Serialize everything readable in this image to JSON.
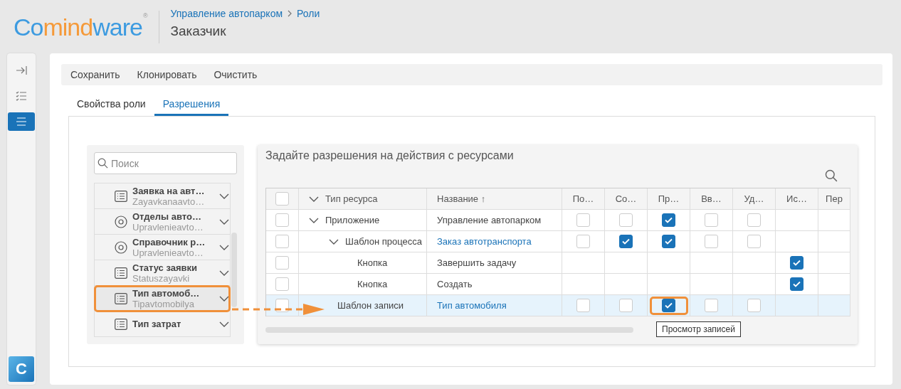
{
  "header": {
    "logo": [
      {
        "text": "Co",
        "color": "#3d9be0"
      },
      {
        "text": "mind",
        "color": "#f59a3a"
      },
      {
        "text": "ware",
        "color": "#3d9be0"
      }
    ],
    "logo_mark": "®",
    "breadcrumb": [
      "Управление автопарком",
      "Роли"
    ],
    "title": "Заказчик"
  },
  "rail": {
    "items": [
      {
        "kind": "collapse",
        "selected": false
      },
      {
        "kind": "checklist",
        "selected": false
      },
      {
        "kind": "menu",
        "selected": true
      }
    ],
    "app_badge": "C"
  },
  "toolbar": [
    "Сохранить",
    "Клонировать",
    "Очистить"
  ],
  "tabs": [
    {
      "label": "Свойства роли",
      "selected": false
    },
    {
      "label": "Разрешения",
      "selected": true
    }
  ],
  "resource_list": {
    "search": {
      "placeholder": "Поиск"
    },
    "items": [
      {
        "kind": "list",
        "title": "Заявка на авт…",
        "subtitle": "Zayavkanaavto…",
        "highlighted": false
      },
      {
        "kind": "target",
        "title": "Отделы авто…",
        "subtitle": "Upravlenieavto…",
        "highlighted": false
      },
      {
        "kind": "target",
        "title": "Справочник р…",
        "subtitle": "Upravlenieavto…",
        "highlighted": false
      },
      {
        "kind": "list",
        "title": "Статус заявки",
        "subtitle": "Statuszayavki",
        "highlighted": false
      },
      {
        "kind": "list",
        "title": "Тип автомоб…",
        "subtitle": "Tipavtomobilya",
        "highlighted": true
      },
      {
        "kind": "list",
        "title": "Тип затрат",
        "highlighted": false
      }
    ]
  },
  "permissions": {
    "title": "Задайте разрешения на действия с ресурсами",
    "header_checked": false,
    "columns": [
      "Тип ресурса",
      "Название ↑",
      "По…",
      "Со…",
      "Пр…",
      "Вв…",
      "Уд…",
      "Ис…",
      "Пер"
    ],
    "rows": [
      {
        "type": "Приложение",
        "name": "Управление автопарком",
        "link": false,
        "checked": false,
        "selected": false,
        "expanded": true,
        "cells": [
          {
            "checked": false,
            "highlighted": false
          },
          {
            "checked": false,
            "highlighted": false
          },
          {
            "checked": true,
            "highlighted": false
          },
          {
            "checked": false,
            "highlighted": false
          },
          {
            "checked": false,
            "highlighted": false
          },
          null,
          null
        ],
        "children": [
          {
            "type": "Шаблон процесса",
            "name": "Заказ автотранспорта",
            "link": true,
            "checked": false,
            "selected": false,
            "expanded": true,
            "cells": [
              {
                "checked": false,
                "highlighted": false
              },
              {
                "checked": true,
                "highlighted": false
              },
              {
                "checked": true,
                "highlighted": false
              },
              {
                "checked": false,
                "highlighted": false
              },
              {
                "checked": false,
                "highlighted": false
              },
              null,
              null
            ],
            "children": [
              {
                "type": "Кнопка",
                "name": "Завершить задачу",
                "link": false,
                "checked": false,
                "selected": false,
                "cells": [
                  null,
                  null,
                  null,
                  null,
                  null,
                  {
                    "checked": true,
                    "highlighted": false
                  },
                  null
                ]
              },
              {
                "type": "Кнопка",
                "name": "Создать",
                "link": false,
                "checked": false,
                "selected": false,
                "cells": [
                  null,
                  null,
                  null,
                  null,
                  null,
                  {
                    "checked": true,
                    "highlighted": false
                  },
                  null
                ]
              }
            ]
          },
          {
            "type": "Шаблон записи",
            "name": "Тип автомобиля",
            "link": true,
            "checked": false,
            "selected": true,
            "cells": [
              {
                "checked": false,
                "highlighted": false
              },
              {
                "checked": false,
                "highlighted": false
              },
              {
                "checked": true,
                "highlighted": true
              },
              {
                "checked": false,
                "highlighted": false
              },
              {
                "checked": false,
                "highlighted": false
              },
              null,
              null
            ]
          }
        ]
      }
    ],
    "tooltip": "Просмотр записей"
  }
}
